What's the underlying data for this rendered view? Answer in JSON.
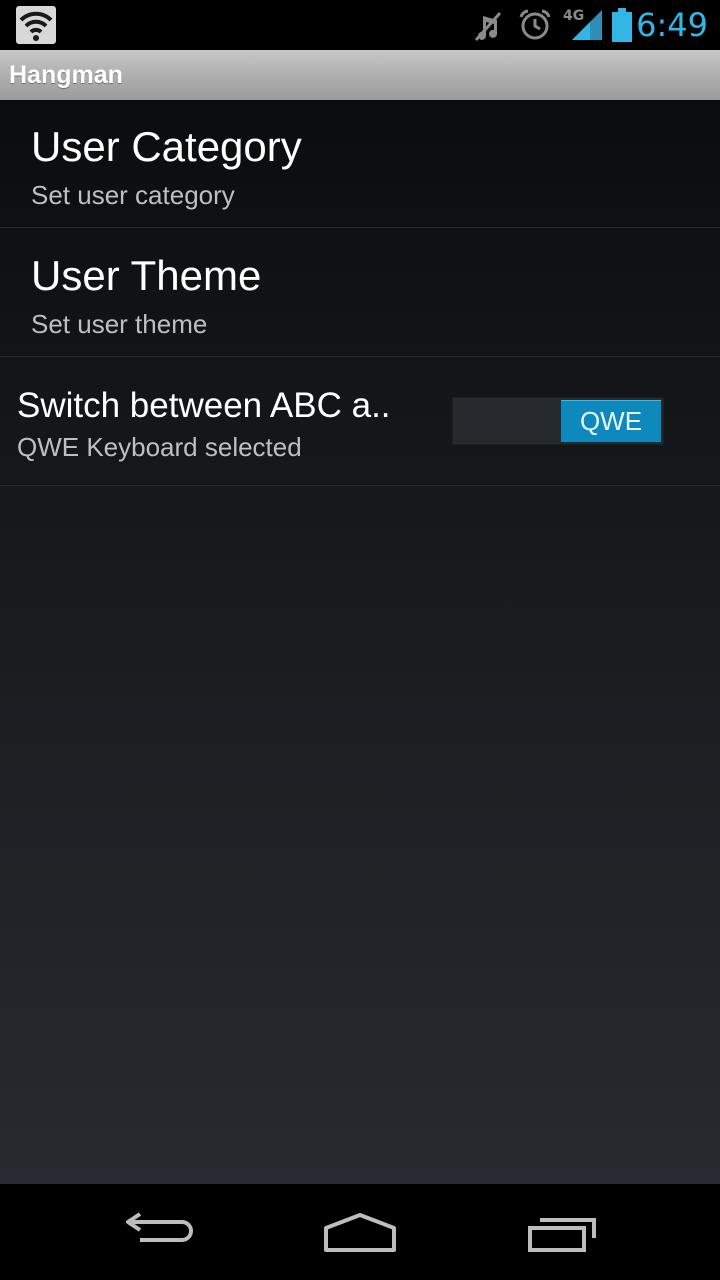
{
  "status_bar": {
    "time": "6:49",
    "network_label": "4G",
    "icons": [
      "wifi-icon",
      "mute-icon",
      "alarm-icon",
      "signal-icon",
      "battery-icon"
    ],
    "accent_color": "#33b5e5"
  },
  "app": {
    "title": "Hangman"
  },
  "preferences": {
    "items": [
      {
        "title": "User Category",
        "summary": "Set user category"
      },
      {
        "title": "User Theme",
        "summary": "Set user theme"
      },
      {
        "title": "Switch between ABC a..",
        "summary": "QWE Keyboard selected",
        "toggle_label": "QWE",
        "toggle_color": "#0e89be"
      }
    ]
  },
  "nav_bar": {
    "icons": [
      "back-icon",
      "home-icon",
      "recent-apps-icon"
    ]
  }
}
